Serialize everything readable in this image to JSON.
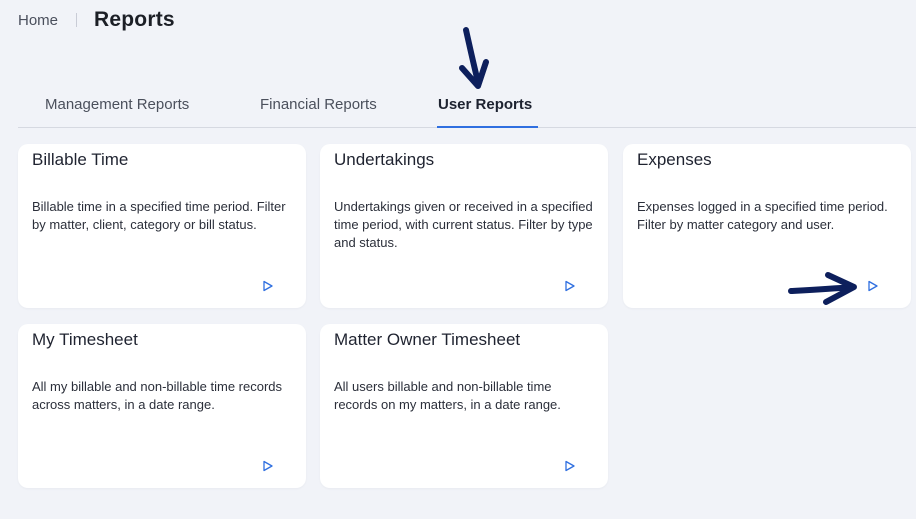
{
  "breadcrumb": {
    "home": "Home"
  },
  "header": {
    "title": "Reports"
  },
  "tabs": [
    {
      "label": "Management Reports",
      "active": false
    },
    {
      "label": "Financial Reports",
      "active": false
    },
    {
      "label": "User Reports",
      "active": true
    }
  ],
  "cards": [
    {
      "title": "Billable Time",
      "description": "Billable time in a specified time period. Filter by matter, client, category or bill status.",
      "action_icon": "play-icon"
    },
    {
      "title": "Undertakings",
      "description": "Undertakings given or received in a specified time period, with current status. Filter by type and status.",
      "action_icon": "play-icon"
    },
    {
      "title": "Expenses",
      "description": "Expenses logged in a specified time period. Filter by matter category and user.",
      "action_icon": "play-icon"
    },
    {
      "title": "My Timesheet",
      "description": "All my billable and non-billable time records across matters, in a date range.",
      "action_icon": "play-icon"
    },
    {
      "title": "Matter Owner Timesheet",
      "description": "All users billable and non-billable time records on my matters, in a date range.",
      "action_icon": "play-icon"
    }
  ],
  "colors": {
    "accent": "#2f6fe0",
    "background": "#f1f3f8",
    "annotation_arrow": "#0d1f5c"
  }
}
